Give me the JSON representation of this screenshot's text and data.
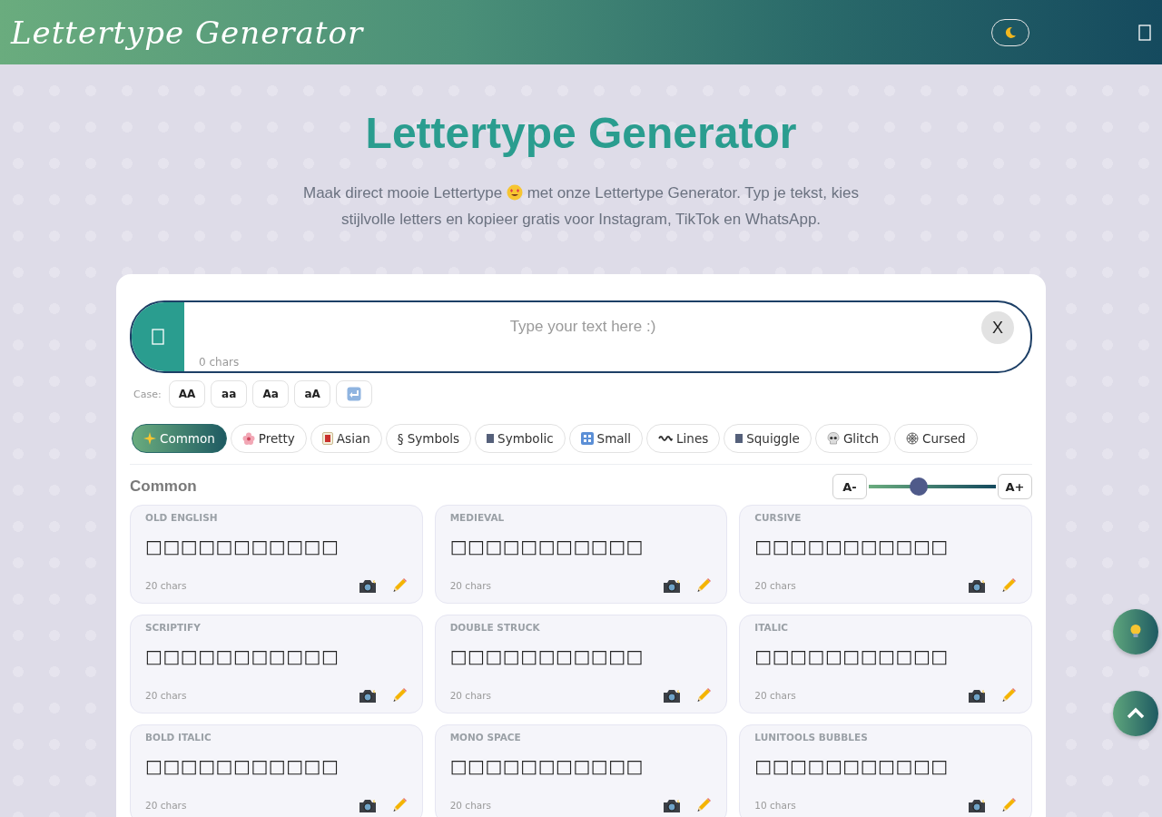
{
  "header": {
    "logo": "Lettertype Generator"
  },
  "hero": {
    "title": "Lettertype Generator",
    "subtitle_line_1": "Maak direct mooie Lettertype",
    "subtitle_line_1_end": "met onze Lettertype Generator. Typ je tekst, kies",
    "subtitle_line_2": "stijlvolle letters en kopieer gratis voor Instagram, TikTok en WhatsApp."
  },
  "input": {
    "placeholder": "Type your text here :)",
    "counter": "0 chars",
    "clear": "X"
  },
  "case": {
    "label": "Case:",
    "buttons": [
      "AA",
      "aa",
      "Aa",
      "aA"
    ]
  },
  "categories": [
    {
      "label": "Common",
      "selected": true
    },
    {
      "label": "Pretty",
      "selected": false
    },
    {
      "label": "Asian",
      "selected": false
    },
    {
      "label": "§ Symbols",
      "selected": false
    },
    {
      "label": "Symbolic",
      "selected": false
    },
    {
      "label": "Small",
      "selected": false
    },
    {
      "label": "Lines",
      "selected": false
    },
    {
      "label": "Squiggle",
      "selected": false
    },
    {
      "label": "Glitch",
      "selected": false
    },
    {
      "label": "Cursed",
      "selected": false
    }
  ],
  "section": {
    "title": "Common",
    "size_down": "A-",
    "size_up": "A+",
    "slider": {
      "level": 0.39
    }
  },
  "fonts": [
    {
      "name": "OLD ENGLISH",
      "preview": "□□□□□□□□□□□",
      "count": "20 chars"
    },
    {
      "name": "MEDIEVAL",
      "preview": "□□□□□□□□□□□",
      "count": "20 chars"
    },
    {
      "name": "CURSIVE",
      "preview": "□□□□□□□□□□□",
      "count": "20 chars"
    },
    {
      "name": "SCRIPTIFY",
      "preview": "□□□□□□□□□□□",
      "count": "20 chars"
    },
    {
      "name": "DOUBLE STRUCK",
      "preview": "□□□□□□□□□□□",
      "count": "20 chars"
    },
    {
      "name": "ITALIC",
      "preview": "□□□□□□□□□□□",
      "count": "20 chars"
    },
    {
      "name": "BOLD ITALIC",
      "preview": "□□□□□□□□□□□",
      "count": "20 chars"
    },
    {
      "name": "MONO SPACE",
      "preview": "□□□□□□□□□□□",
      "count": "20 chars"
    },
    {
      "name": "LUNITOOLS BUBBLES",
      "preview": "□□□□□□□□□□□",
      "count": "10 chars"
    }
  ]
}
